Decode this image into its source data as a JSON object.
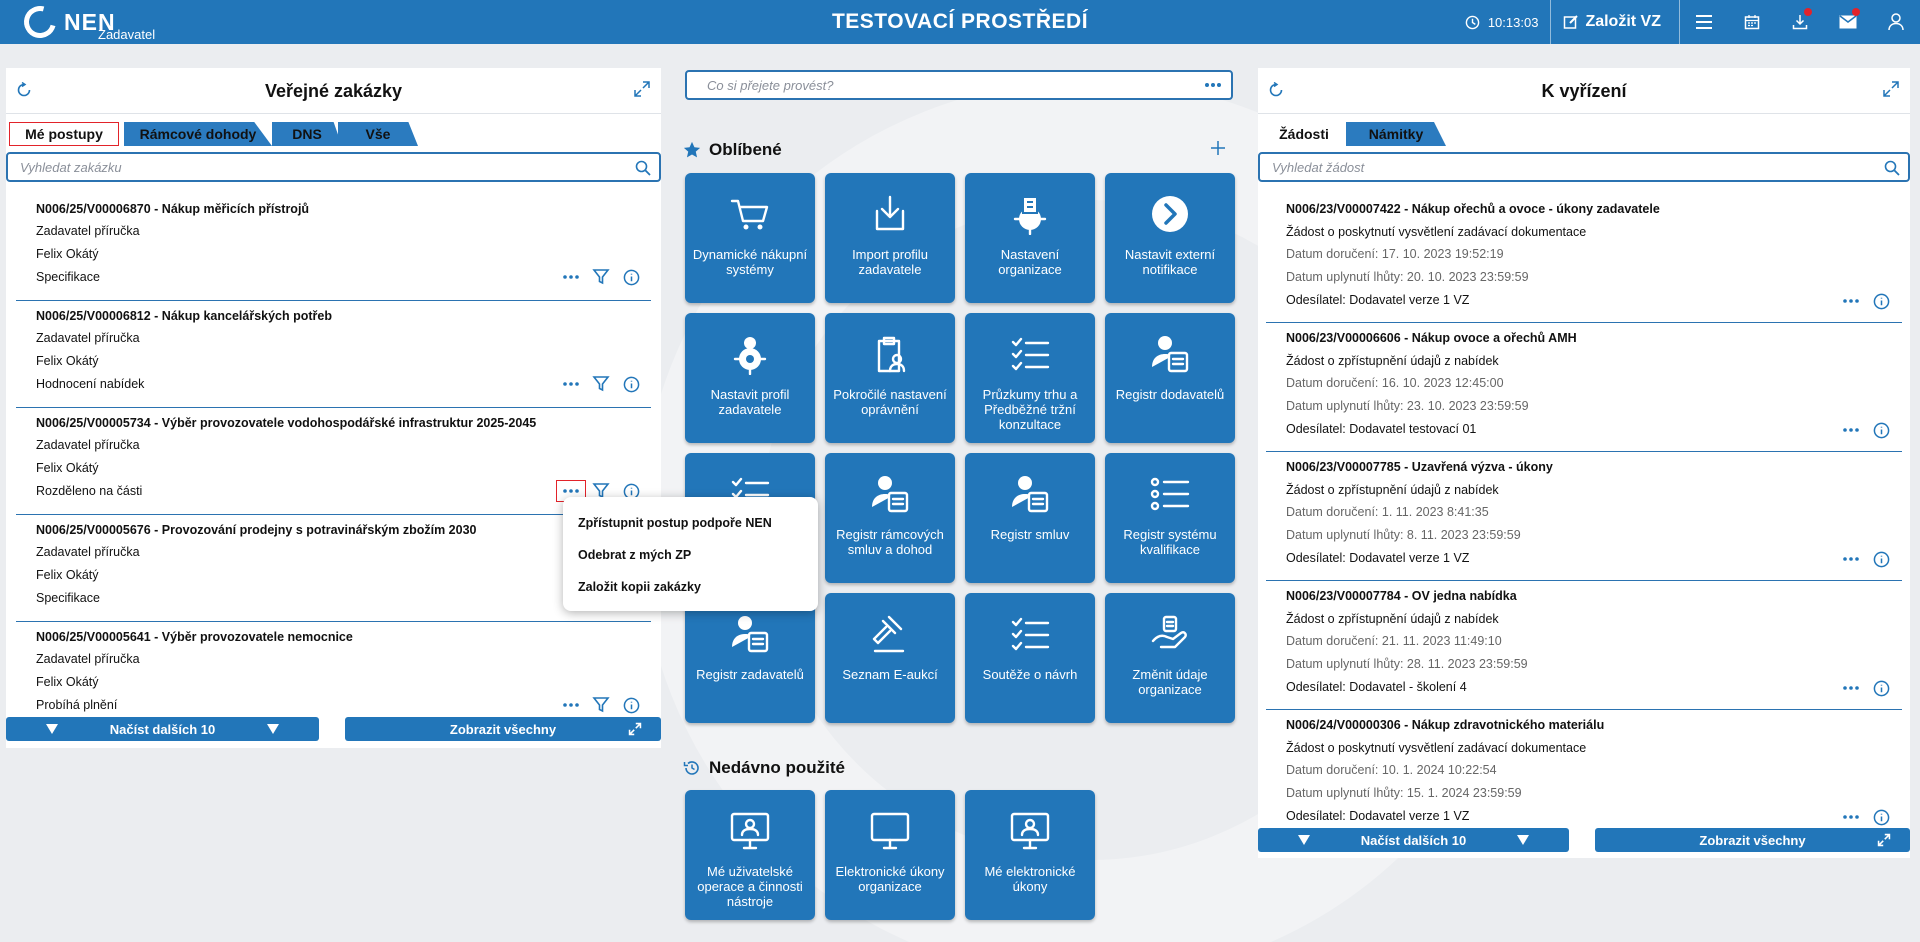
{
  "topbar": {
    "logo": "NEN",
    "role": "Zadavatel",
    "env": "TESTOVACÍ PROSTŘEDÍ",
    "time": "10:13:03",
    "new_vz": "Založit VZ"
  },
  "left": {
    "title": "Veřejné zakázky",
    "tabs": [
      "Mé postupy",
      "Rámcové dohody",
      "DNS",
      "Vše"
    ],
    "search_placeholder": "Vyhledat zakázku",
    "items": [
      {
        "title": "N006/25/V00006870 - Nákup měřicích přístrojů",
        "a": "Zadavatel příručka",
        "b": "Felix Okátý",
        "c": "Specifikace"
      },
      {
        "title": "N006/25/V00006812 - Nákup kancelářských potřeb",
        "a": "Zadavatel příručka",
        "b": "Felix Okátý",
        "c": "Hodnocení nabídek"
      },
      {
        "title": "N006/25/V00005734 - Výběr provozovatele vodohospodářské infrastruktur 2025-2045",
        "a": "Zadavatel příručka",
        "b": "Felix Okátý",
        "c": "Rozděleno na části"
      },
      {
        "title": "N006/25/V00005676 - Provozování prodejny s potravinářským zbožím 2030",
        "a": "Zadavatel příručka",
        "b": "Felix Okátý",
        "c": "Specifikace"
      },
      {
        "title": "N006/25/V00005641 - Výběr provozovatele nemocnice",
        "a": "Zadavatel příručka",
        "b": "Felix Okátý",
        "c": "Probíhá plnění"
      }
    ],
    "load_more": "Načíst dalších 10",
    "show_all": "Zobrazit všechny"
  },
  "popup": [
    "Zpřístupnit postup podpoře NEN",
    "Odebrat z mých ZP",
    "Založit kopii zakázky"
  ],
  "middle": {
    "search_placeholder": "Co si přejete provést?",
    "favorites_title": "Oblíbené",
    "recent_title": "Nedávno použité",
    "favorites": [
      {
        "label": "Dynamické nákupní systémy",
        "icon": "cart-icon"
      },
      {
        "label": "Import profilu zadavatele",
        "icon": "import-icon"
      },
      {
        "label": "Nastavení organizace",
        "icon": "org-gear-icon"
      },
      {
        "label": "Nastavit externí notifikace",
        "icon": "arrow-circle-icon"
      },
      {
        "label": "Nastavit profil zadavatele",
        "icon": "profile-gear-icon"
      },
      {
        "label": "Pokročilé nastavení oprávnění",
        "icon": "clipboard-user-icon"
      },
      {
        "label": "Průzkumy trhu a Předběžné tržní konzultace",
        "icon": "checklist-icon"
      },
      {
        "label": "Registr dodavatelů",
        "icon": "user-card-icon"
      },
      {
        "label": "",
        "icon": "checklist-icon"
      },
      {
        "label": "Registr rámcových smluv a dohod",
        "icon": "user-card-icon"
      },
      {
        "label": "Registr smluv",
        "icon": "user-card-icon"
      },
      {
        "label": "Registr systému kvalifikace",
        "icon": "list-icon"
      },
      {
        "label": "Registr zadavatelů",
        "icon": "user-card-icon"
      },
      {
        "label": "Seznam E-aukcí",
        "icon": "gavel-icon"
      },
      {
        "label": "Soutěže o návrh",
        "icon": "checklist-icon"
      },
      {
        "label": "Změnit údaje organizace",
        "icon": "org-hand-icon"
      }
    ],
    "recent": [
      {
        "label": "Mé uživatelské operace a činnosti nástroje",
        "icon": "monitor-user-icon"
      },
      {
        "label": "Elektronické úkony organizace",
        "icon": "monitor-icon"
      },
      {
        "label": "Mé elektronické úkony",
        "icon": "monitor-user-icon"
      }
    ]
  },
  "right": {
    "title": "K vyřízení",
    "tabs": [
      "Žádosti",
      "Námitky"
    ],
    "search_placeholder": "Vyhledat žádost",
    "items": [
      {
        "title": "N006/23/V00007422 - Nákup ořechů a ovoce - úkony zadavatele",
        "type": "Žádost o poskytnutí vysvětlení zadávací dokumentace",
        "received": "Datum doručení: 17. 10. 2023 19:52:19",
        "deadline": "Datum uplynutí lhůty: 20. 10. 2023 23:59:59",
        "sender": "Odesílatel: Dodavatel verze 1 VZ"
      },
      {
        "title": "N006/23/V00006606 - Nákup ovoce a ořechů AMH",
        "type": "Žádost o zpřístupnění údajů z nabídek",
        "received": "Datum doručení: 16. 10. 2023 12:45:00",
        "deadline": "Datum uplynutí lhůty: 23. 10. 2023 23:59:59",
        "sender": "Odesílatel: Dodavatel testovací 01"
      },
      {
        "title": "N006/23/V00007785 - Uzavřená výzva - úkony",
        "type": "Žádost o zpřístupnění údajů z nabídek",
        "received": "Datum doručení: 1. 11. 2023 8:41:35",
        "deadline": "Datum uplynutí lhůty: 8. 11. 2023 23:59:59",
        "sender": "Odesílatel: Dodavatel verze 1 VZ"
      },
      {
        "title": "N006/23/V00007784 - OV jedna nabídka",
        "type": "Žádost o zpřístupnění údajů z nabídek",
        "received": "Datum doručení: 21. 11. 2023 11:49:10",
        "deadline": "Datum uplynutí lhůty: 28. 11. 2023 23:59:59",
        "sender": "Odesílatel: Dodavatel - školení 4"
      },
      {
        "title": "N006/24/V00000306 - Nákup zdravotnického materiálu",
        "type": "Žádost o poskytnutí vysvětlení zadávací dokumentace",
        "received": "Datum doručení: 10. 1. 2024 10:22:54",
        "deadline": "Datum uplynutí lhůty: 15. 1. 2024 23:59:59",
        "sender": "Odesílatel: Dodavatel verze 1 VZ"
      }
    ],
    "load_more": "Načíst dalších 10",
    "show_all": "Zobrazit všechny"
  }
}
